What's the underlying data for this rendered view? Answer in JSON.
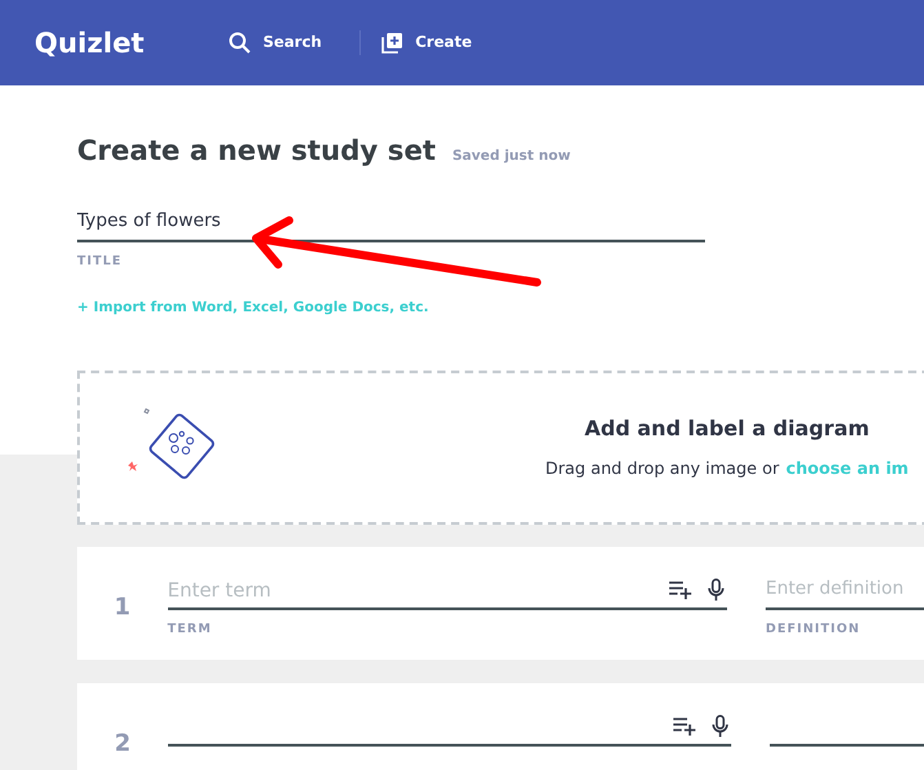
{
  "header": {
    "logo": "Quizlet",
    "nav": [
      {
        "kind": "search",
        "label": "Search"
      },
      {
        "kind": "create",
        "label": "Create"
      }
    ]
  },
  "page": {
    "title": "Create a new study set",
    "status": "Saved just now"
  },
  "title_field": {
    "value": "Types of flowers",
    "label": "TITLE"
  },
  "import_link": "+ Import from Word, Excel, Google Docs, etc.",
  "diagram": {
    "title": "Add and label a diagram",
    "text": "Drag and drop any image or",
    "link": "choose an im"
  },
  "cards": [
    {
      "number": "1",
      "term_placeholder": "Enter term",
      "term_label": "TERM",
      "definition_placeholder": "Enter definition",
      "definition_label": "DEFINITION"
    },
    {
      "number": "2"
    }
  ]
}
